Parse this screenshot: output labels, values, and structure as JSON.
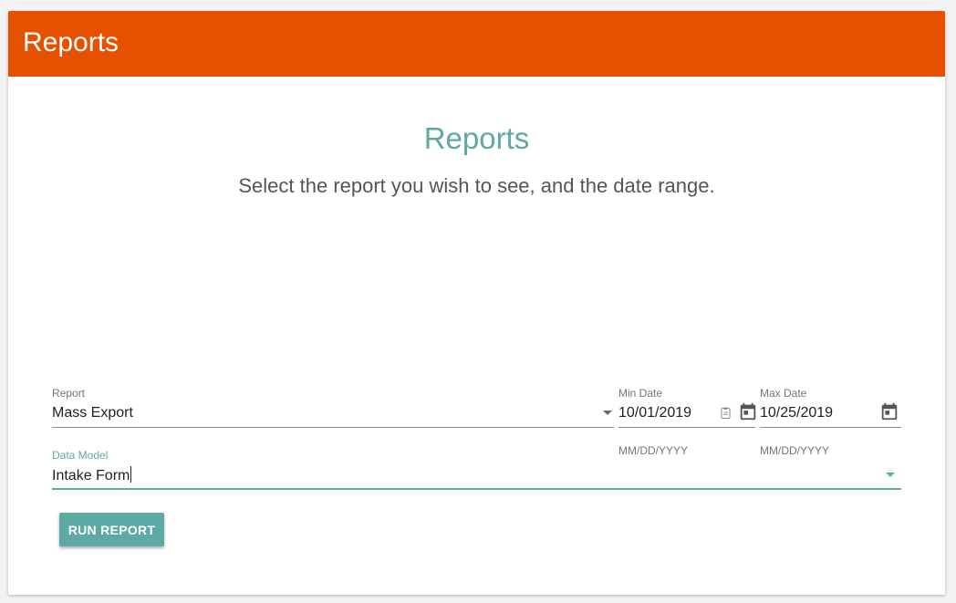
{
  "toolbar": {
    "title": "Reports",
    "background_color": "#e65100"
  },
  "main": {
    "heading": "Reports",
    "subheading": "Select the report you wish to see, and the date range."
  },
  "form": {
    "report": {
      "label": "Report",
      "value": "Mass Export"
    },
    "min_date": {
      "label": "Min Date",
      "value": "10/01/2019",
      "hint": "MM/DD/YYYY"
    },
    "max_date": {
      "label": "Max Date",
      "value": "10/25/2019",
      "hint": "MM/DD/YYYY"
    },
    "data_model": {
      "label": "Data Model",
      "value": "Intake Form"
    },
    "run_button_label": "RUN REPORT"
  },
  "icons": {
    "report_dropdown": "chevron-down-icon",
    "min_date_input_icon": "clipboard-icon",
    "min_date_picker": "calendar-icon",
    "max_date_picker": "calendar-icon",
    "data_model_dropdown": "chevron-down-icon"
  },
  "colors": {
    "accent": "#5ea9a3",
    "text": "#212121",
    "label": "#757575"
  }
}
